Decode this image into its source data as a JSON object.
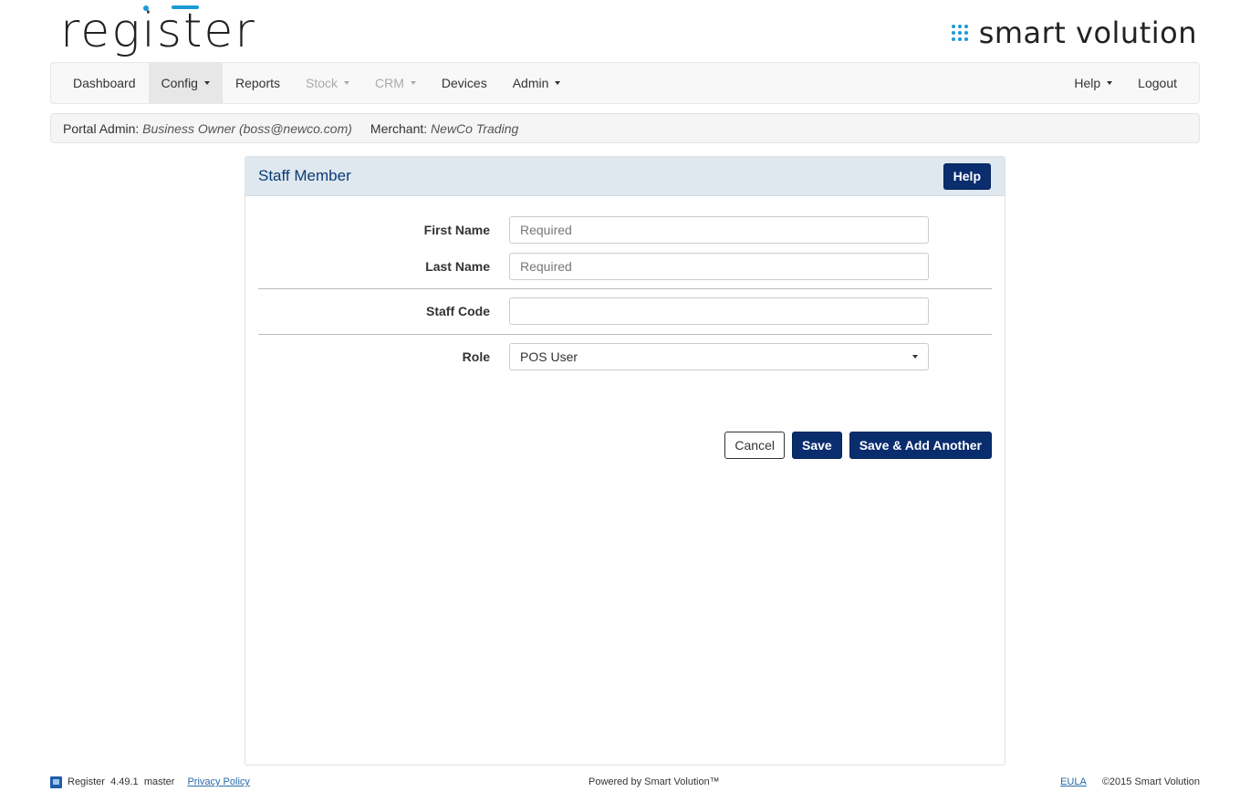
{
  "brand": {
    "app_logo_text": "register",
    "company_logo_text": "smart volution"
  },
  "nav": {
    "left": [
      {
        "label": "Dashboard"
      },
      {
        "label": "Config"
      },
      {
        "label": "Reports"
      },
      {
        "label": "Stock"
      },
      {
        "label": "CRM"
      },
      {
        "label": "Devices"
      },
      {
        "label": "Admin"
      }
    ],
    "right": [
      {
        "label": "Help"
      },
      {
        "label": "Logout"
      }
    ],
    "active": "Config",
    "disabled": [
      "Stock",
      "CRM"
    ]
  },
  "info": {
    "portal_admin_label": "Portal Admin:",
    "portal_admin_value": "Business Owner (boss@newco.com)",
    "merchant_label": "Merchant:",
    "merchant_value": "NewCo Trading"
  },
  "panel": {
    "title": "Staff Member",
    "help_label": "Help"
  },
  "form": {
    "first_name": {
      "label": "First Name",
      "placeholder": "Required",
      "value": ""
    },
    "last_name": {
      "label": "Last Name",
      "placeholder": "Required",
      "value": ""
    },
    "staff_code": {
      "label": "Staff Code",
      "placeholder": "",
      "value": ""
    },
    "role": {
      "label": "Role",
      "selected": "POS User"
    }
  },
  "actions": {
    "cancel": "Cancel",
    "save": "Save",
    "save_add": "Save & Add Another"
  },
  "footer": {
    "app_name": "Register",
    "version": "4.49.1",
    "branch": "master",
    "privacy": "Privacy Policy",
    "powered": "Powered by Smart Volution™",
    "eula": "EULA",
    "copyright": "©2015 Smart Volution"
  },
  "colors": {
    "primary": "#0a2d6e",
    "accent": "#1a9bd7",
    "panel_heading_bg": "#dfe7ef"
  }
}
